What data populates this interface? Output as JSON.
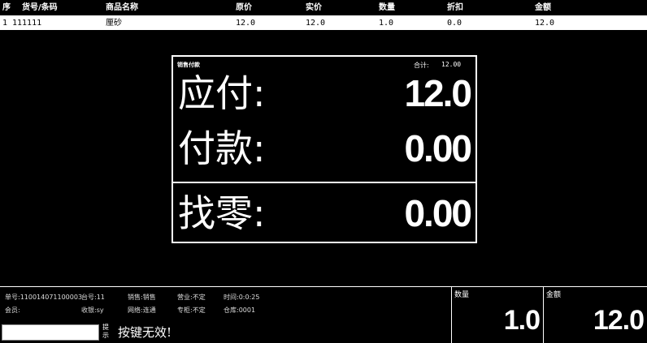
{
  "table": {
    "headers": [
      "序",
      "货号/条码",
      "商品名称",
      "原价",
      "实价",
      "数量",
      "折扣",
      "金额"
    ],
    "rows": [
      {
        "seq": "1",
        "code": "111111",
        "name": "厘砂",
        "orig_price": "12.0",
        "real_price": "12.0",
        "qty": "1.0",
        "discount": "0.0",
        "amount": "12.0"
      }
    ]
  },
  "dialog": {
    "title": "销售付款",
    "total_label": "合计:",
    "total_value": "12.00",
    "due_label": "应付:",
    "due_value": "12.0",
    "paid_label": "付款:",
    "paid_value": "0.00",
    "change_label": "找零:",
    "change_value": "0.00"
  },
  "status": {
    "order_no": "单号:110014071100003",
    "register": "台号:11",
    "sale_type": "销售:销售",
    "business": "营业:不定",
    "time": "时间:0:0:25",
    "member": "会员:",
    "cashier": "收银:sy",
    "network": "网络:连通",
    "counter": "专柜:不定",
    "warehouse": "仓库:0001",
    "hint_tag": "提示",
    "hint_message": "按键无效!"
  },
  "summary": {
    "qty_label": "数量",
    "qty_value": "1.0",
    "amount_label": "金额",
    "amount_value": "12.0"
  }
}
